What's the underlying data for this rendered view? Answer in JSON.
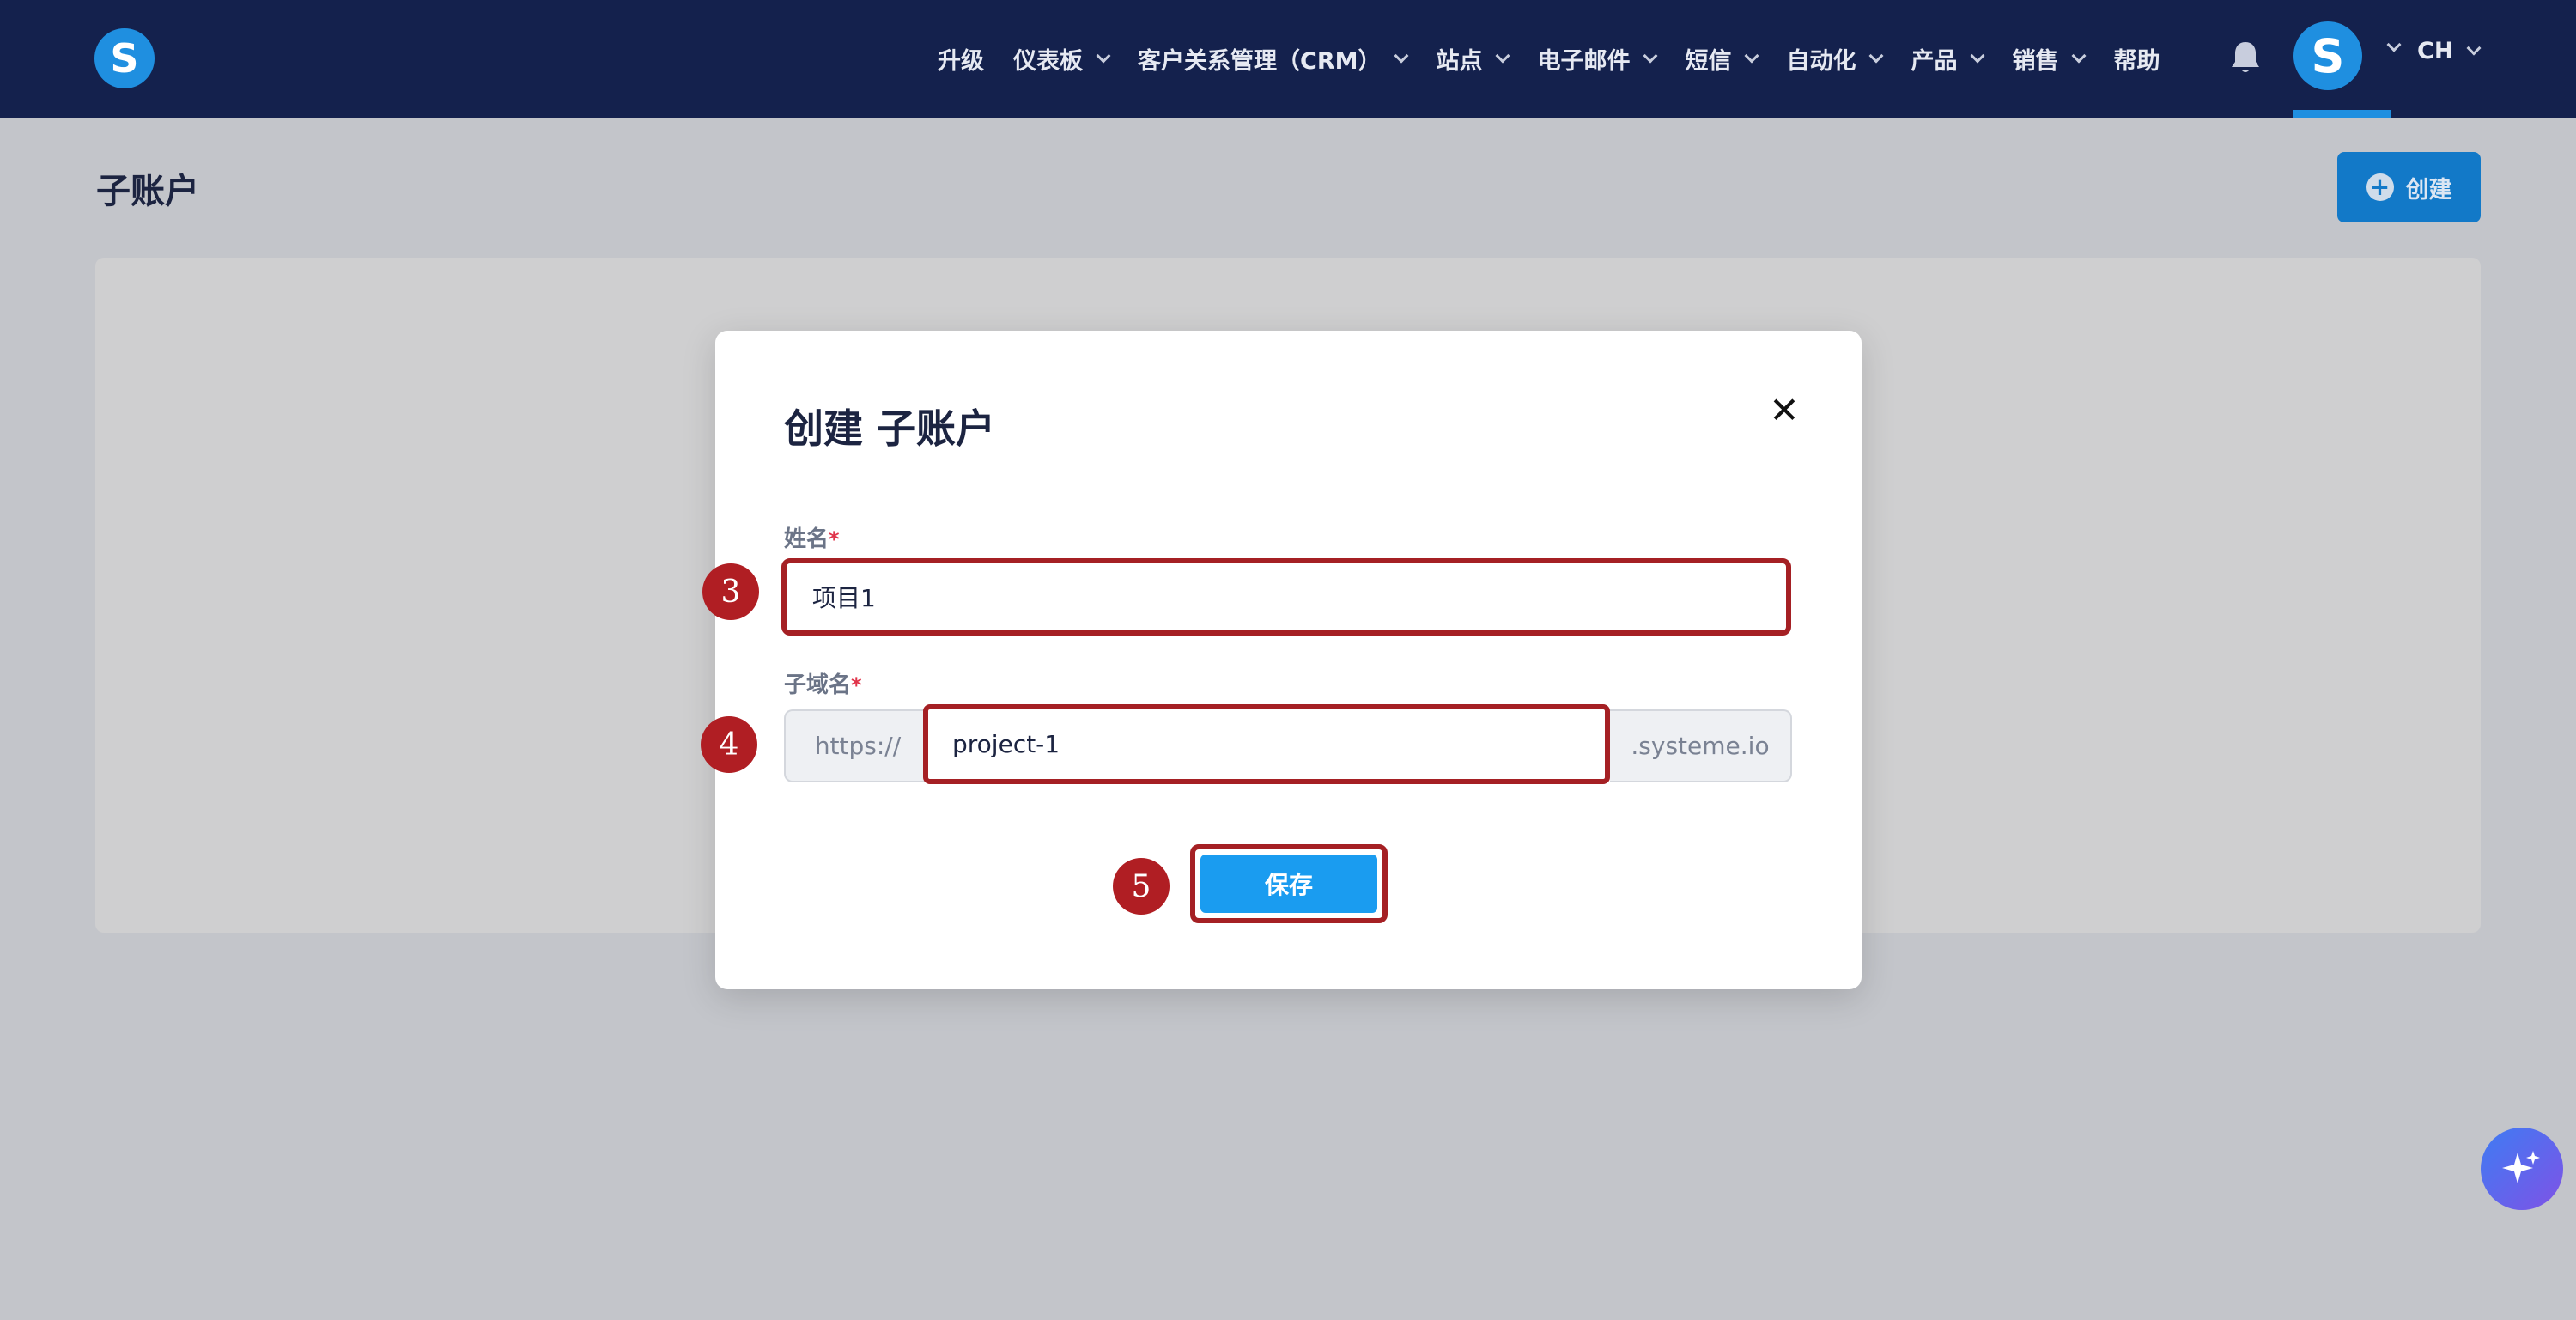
{
  "app": {
    "logo_letter": "S",
    "accent_color": "#1f8fe0",
    "nav_bg_color": "#14214d"
  },
  "nav": {
    "items": [
      {
        "label": "升级",
        "has_dropdown": false
      },
      {
        "label": "仪表板",
        "has_dropdown": true
      },
      {
        "label": "客户关系管理（CRM）",
        "has_dropdown": true
      },
      {
        "label": "站点",
        "has_dropdown": true
      },
      {
        "label": "电子邮件",
        "has_dropdown": true
      },
      {
        "label": "短信",
        "has_dropdown": true
      },
      {
        "label": "自动化",
        "has_dropdown": true
      },
      {
        "label": "产品",
        "has_dropdown": true
      },
      {
        "label": "销售",
        "has_dropdown": true
      },
      {
        "label": "帮助",
        "has_dropdown": false
      }
    ],
    "notification_icon": "bell-icon",
    "avatar_letter": "S",
    "language": "CH"
  },
  "page": {
    "title": "子账户",
    "create_button_label": "创建",
    "create_button_icon": "plus-circle-icon"
  },
  "modal": {
    "title": "创建 子账户",
    "close_icon": "close-icon",
    "name_field": {
      "label": "姓名",
      "required_mark": "*",
      "value": "项目1"
    },
    "subdomain_field": {
      "label": "子域名",
      "required_mark": "*",
      "prefix": "https://",
      "value": "project-1",
      "suffix": ".systeme.io"
    },
    "save_button_label": "保存"
  },
  "annotations": {
    "step_name": "3",
    "step_subdomain": "4",
    "step_save": "5",
    "highlight_color": "#a52024"
  },
  "fab": {
    "icon": "sparkle-icon"
  }
}
